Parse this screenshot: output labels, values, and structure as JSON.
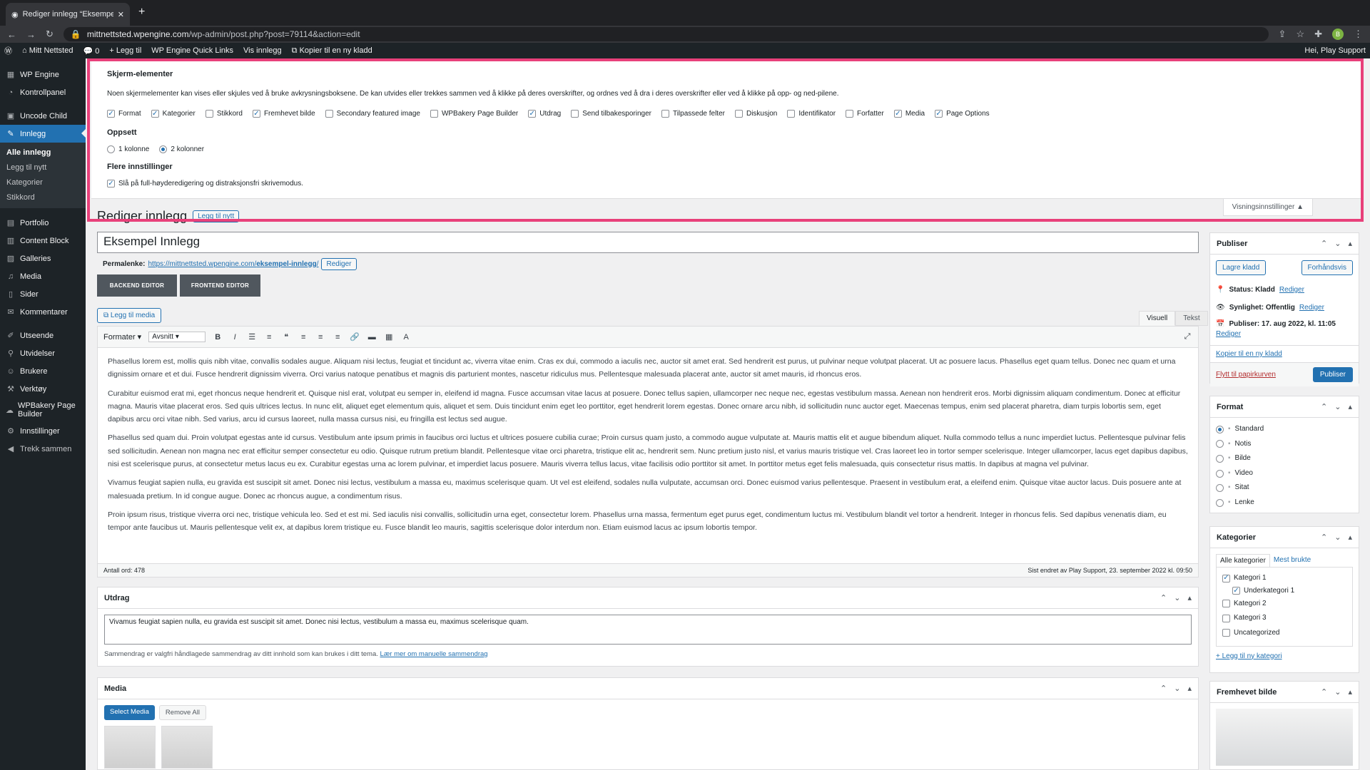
{
  "browser": {
    "tab_title": "Rediger innlegg “Eksempel Inn…",
    "url_host": "mittnettsted.wpengine.com",
    "url_path": "/wp-admin/post.php?post=79114&action=edit",
    "profile": "B"
  },
  "adminbar": {
    "site": "Mitt Nettsted",
    "comments": "0",
    "new": "+ Legg til",
    "quick": "WP Engine Quick Links",
    "view": "Vis innlegg",
    "copy": "Kopier til en ny kladd",
    "greeting": "Hei, Play Support"
  },
  "sidebar": {
    "items": [
      {
        "label": "WP Engine",
        "icon": "wpengine-icon"
      },
      {
        "label": "Kontrollpanel",
        "icon": "dashboard-icon"
      },
      {
        "label": "Uncode Child",
        "icon": "theme-icon"
      },
      {
        "label": "Innlegg",
        "icon": "pin-icon",
        "active": true
      },
      {
        "label": "Portfolio",
        "icon": "grid-icon"
      },
      {
        "label": "Content Block",
        "icon": "block-icon"
      },
      {
        "label": "Galleries",
        "icon": "gallery-icon"
      },
      {
        "label": "Media",
        "icon": "media-icon"
      },
      {
        "label": "Sider",
        "icon": "page-icon"
      },
      {
        "label": "Kommentarer",
        "icon": "comment-icon"
      },
      {
        "label": "Utseende",
        "icon": "brush-icon"
      },
      {
        "label": "Utvidelser",
        "icon": "plugin-icon"
      },
      {
        "label": "Brukere",
        "icon": "user-icon"
      },
      {
        "label": "Verktøy",
        "icon": "wrench-icon"
      },
      {
        "label": "WPBakery Page Builder",
        "icon": "builder-icon"
      },
      {
        "label": "Innstillinger",
        "icon": "settings-icon"
      },
      {
        "label": "Trekk sammen",
        "icon": "collapse-icon"
      }
    ],
    "submenu": [
      "Alle innlegg",
      "Legg til nytt",
      "Kategorier",
      "Stikkord"
    ]
  },
  "screen_options": {
    "heading": "Skjerm-elementer",
    "desc": "Noen skjermelementer kan vises eller skjules ved å bruke avkrysningsboksene. De kan utvides eller trekkes sammen ved å klikke på deres overskrifter, og ordnes ved å dra i deres overskrifter eller ved å klikke på opp- og ned-pilene.",
    "checkboxes": [
      {
        "label": "Format",
        "checked": true
      },
      {
        "label": "Kategorier",
        "checked": true
      },
      {
        "label": "Stikkord",
        "checked": false
      },
      {
        "label": "Fremhevet bilde",
        "checked": true
      },
      {
        "label": "Secondary featured image",
        "checked": false
      },
      {
        "label": "WPBakery Page Builder",
        "checked": false
      },
      {
        "label": "Utdrag",
        "checked": true
      },
      {
        "label": "Send tilbakesporinger",
        "checked": false
      },
      {
        "label": "Tilpassede felter",
        "checked": false
      },
      {
        "label": "Diskusjon",
        "checked": false
      },
      {
        "label": "Identifikator",
        "checked": false
      },
      {
        "label": "Forfatter",
        "checked": false
      },
      {
        "label": "Media",
        "checked": true
      },
      {
        "label": "Page Options",
        "checked": true
      }
    ],
    "layout_heading": "Oppsett",
    "layout1": "1 kolonne",
    "layout2": "2 kolonner",
    "more_heading": "Flere innstillinger",
    "fullheight": "Slå på full-høyderedigering og distraksjonsfri skrivemodus.",
    "toggle": "Visningsinnstillinger ▲"
  },
  "page": {
    "title": "Rediger innlegg",
    "add_new": "Legg til nytt",
    "post_title": "Eksempel Innlegg",
    "permalink_label": "Permalenke:",
    "permalink_base": "https://mittnettsted.wpengine.com/",
    "permalink_slug": "eksempel-innlegg",
    "permalink_end": "/",
    "edit": "Rediger",
    "backend": "BACKEND EDITOR",
    "frontend": "FRONTEND EDITOR",
    "add_media": "Legg til media",
    "tab_visual": "Visuell",
    "tab_text": "Tekst",
    "format_menu": "Formater ▾",
    "paragraph": "Avsnitt",
    "paragraphs": [
      "Phasellus lorem est, mollis quis nibh vitae, convallis sodales augue. Aliquam nisi lectus, feugiat et tincidunt ac, viverra vitae enim. Cras ex dui, commodo a iaculis nec, auctor sit amet erat. Sed hendrerit est purus, ut pulvinar neque volutpat placerat. Ut ac posuere lacus. Phasellus eget quam tellus. Donec nec quam et urna dignissim ornare et et dui. Fusce hendrerit dignissim viverra. Orci varius natoque penatibus et magnis dis parturient montes, nascetur ridiculus mus. Pellentesque malesuada placerat ante, auctor sit amet mauris, id rhoncus eros.",
      "Curabitur euismod erat mi, eget rhoncus neque hendrerit et. Quisque nisl erat, volutpat eu semper in, eleifend id magna. Fusce accumsan vitae lacus at posuere. Donec tellus sapien, ullamcorper nec neque nec, egestas vestibulum massa. Aenean non hendrerit eros. Morbi dignissim aliquam condimentum. Donec at efficitur magna. Mauris vitae placerat eros. Sed quis ultrices lectus. In nunc elit, aliquet eget elementum quis, aliquet et sem. Duis tincidunt enim eget leo porttitor, eget hendrerit lorem egestas. Donec ornare arcu nibh, id sollicitudin nunc auctor eget. Maecenas tempus, enim sed placerat pharetra, diam turpis lobortis sem, eget dapibus arcu orci vitae nibh. Sed varius, arcu id cursus laoreet, nulla massa cursus nisi, eu fringilla est lectus sed augue.",
      "Phasellus sed quam dui. Proin volutpat egestas ante id cursus. Vestibulum ante ipsum primis in faucibus orci luctus et ultrices posuere cubilia curae; Proin cursus quam justo, a commodo augue vulputate at. Mauris mattis elit et augue bibendum aliquet. Nulla commodo tellus a nunc imperdiet luctus. Pellentesque pulvinar felis sed sollicitudin. Aenean non magna nec erat efficitur semper consectetur eu odio. Quisque rutrum pretium blandit. Pellentesque vitae orci pharetra, tristique elit ac, hendrerit sem. Nunc pretium justo nisl, et varius mauris tristique vel. Cras laoreet leo in tortor semper scelerisque. Integer ullamcorper, lacus eget dapibus dapibus, nisi est scelerisque purus, at consectetur metus lacus eu ex. Curabitur egestas urna ac lorem pulvinar, et imperdiet lacus posuere. Mauris viverra tellus lacus, vitae facilisis odio porttitor sit amet. In porttitor metus eget felis malesuada, quis consectetur risus mattis. In dapibus at magna vel pulvinar.",
      "Vivamus feugiat sapien nulla, eu gravida est suscipit sit amet. Donec nisi lectus, vestibulum a massa eu, maximus scelerisque quam. Ut vel est eleifend, sodales nulla vulputate, accumsan orci. Donec euismod varius pellentesque. Praesent in vestibulum erat, a eleifend enim. Quisque vitae auctor lacus. Duis posuere ante at malesuada pretium. In id congue augue. Donec ac rhoncus augue, a condimentum risus.",
      "Proin ipsum risus, tristique viverra orci nec, tristique vehicula leo. Sed et est mi. Sed iaculis nisi convallis, sollicitudin urna eget, consectetur lorem. Phasellus urna massa, fermentum eget purus eget, condimentum luctus mi. Vestibulum blandit vel tortor a hendrerit. Integer in rhoncus felis. Sed dapibus venenatis diam, eu tempor ante faucibus ut. Mauris pellentesque velit ex, at dapibus lorem tristique eu. Fusce blandit leo mauris, sagittis scelerisque dolor interdum non. Etiam euismod lacus ac ipsum lobortis tempor."
    ],
    "word_count": "Antall ord: 478",
    "last_edited": "Sist endret av Play Support, 23. september 2022 kl. 09:50"
  },
  "excerpt": {
    "title": "Utdrag",
    "text": "Vivamus feugiat sapien nulla, eu gravida est suscipit sit amet. Donec nisi lectus, vestibulum a massa eu, maximus scelerisque quam.",
    "help": "Sammendrag er valgfri håndlagede sammendrag av ditt innhold som kan brukes i ditt tema.",
    "help_link": "Lær mer om manuelle sammendrag"
  },
  "media": {
    "title": "Media",
    "select": "Select Media",
    "remove": "Remove All"
  },
  "publish": {
    "title": "Publiser",
    "save": "Lagre kladd",
    "preview": "Forhåndsvis",
    "status": "Status: Kladd",
    "visibility": "Synlighet: Offentlig",
    "date": "Publiser: 17. aug 2022, kl. 11:05",
    "edit": "Rediger",
    "copy": "Kopier til en ny kladd",
    "trash": "Flytt til papirkurven",
    "publish": "Publiser"
  },
  "format": {
    "title": "Format",
    "options": [
      "Standard",
      "Notis",
      "Bilde",
      "Video",
      "Sitat",
      "Lenke"
    ]
  },
  "categories": {
    "title": "Kategorier",
    "tab_all": "Alle kategorier",
    "tab_used": "Mest brukte",
    "items": [
      "Kategori 1",
      "Underkategori 1",
      "Kategori 2",
      "Kategori 3",
      "Uncategorized"
    ],
    "add": "+ Legg til ny kategori"
  },
  "featured": {
    "title": "Fremhevet bilde"
  }
}
